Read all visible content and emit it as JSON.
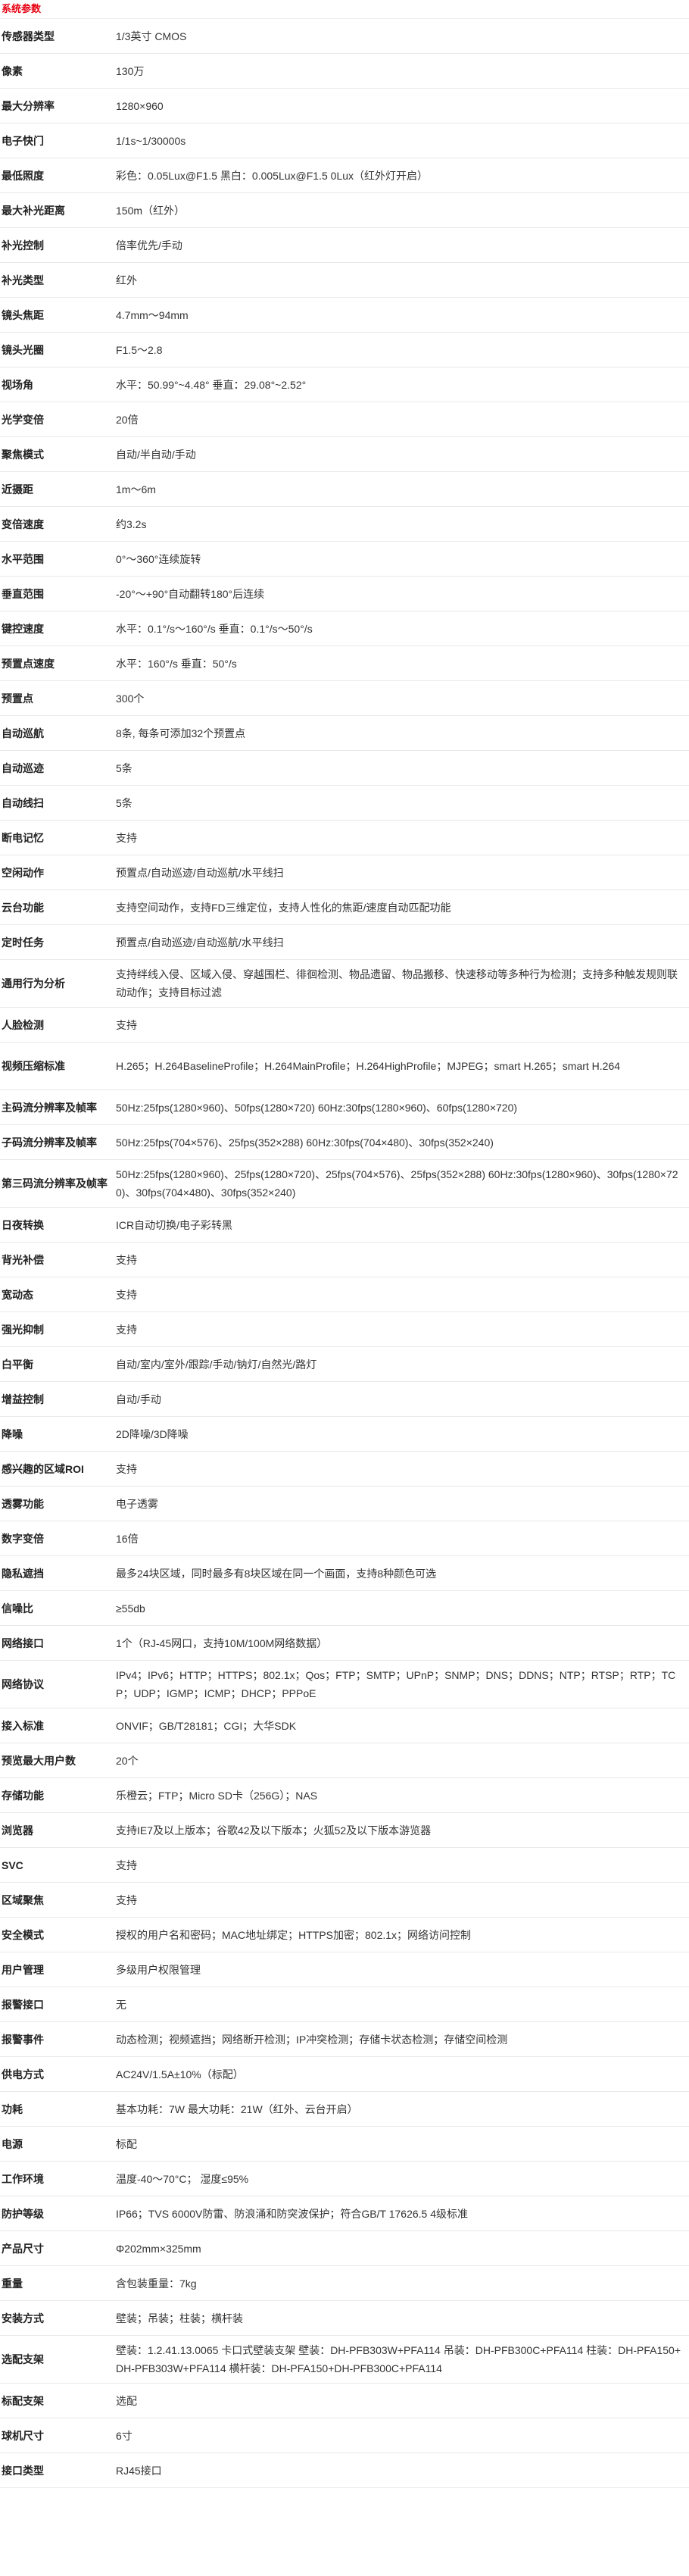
{
  "section_title": "系统参数",
  "rows": [
    {
      "label": "传感器类型",
      "value": "1/3英寸 CMOS"
    },
    {
      "label": "像素",
      "value": "130万"
    },
    {
      "label": "最大分辨率",
      "value": "1280×960"
    },
    {
      "label": "电子快门",
      "value": "1/1s~1/30000s"
    },
    {
      "label": "最低照度",
      "value": "彩色：0.05Lux@F1.5 黑白：0.005Lux@F1.5 0Lux（红外灯开启）"
    },
    {
      "label": "最大补光距离",
      "value": "150m（红外）"
    },
    {
      "label": "补光控制",
      "value": "倍率优先/手动"
    },
    {
      "label": "补光类型",
      "value": "红外"
    },
    {
      "label": "镜头焦距",
      "value": "4.7mm～94mm"
    },
    {
      "label": "镜头光圈",
      "value": "F1.5～2.8"
    },
    {
      "label": "视场角",
      "value": "水平：50.99°~4.48° 垂直：29.08°~2.52°"
    },
    {
      "label": "光学变倍",
      "value": "20倍"
    },
    {
      "label": "聚焦模式",
      "value": "自动/半自动/手动"
    },
    {
      "label": "近摄距",
      "value": "1m～6m"
    },
    {
      "label": "变倍速度",
      "value": "约3.2s"
    },
    {
      "label": "水平范围",
      "value": "0°～360°连续旋转"
    },
    {
      "label": "垂直范围",
      "value": " -20°～+90°自动翻转180°后连续"
    },
    {
      "label": "键控速度",
      "value": "水平：0.1°/s～160°/s 垂直：0.1°/s～50°/s"
    },
    {
      "label": "预置点速度",
      "value": "水平：160°/s 垂直：50°/s"
    },
    {
      "label": "预置点",
      "value": "300个"
    },
    {
      "label": "自动巡航",
      "value": "8条, 每条可添加32个预置点"
    },
    {
      "label": "自动巡迹",
      "value": "5条"
    },
    {
      "label": "自动线扫",
      "value": "5条"
    },
    {
      "label": "断电记忆",
      "value": "支持"
    },
    {
      "label": "空闲动作",
      "value": "预置点/自动巡迹/自动巡航/水平线扫"
    },
    {
      "label": "云台功能",
      "value": "支持空间动作，支持FD三维定位，支持人性化的焦距/速度自动匹配功能"
    },
    {
      "label": "定时任务",
      "value": "预置点/自动巡迹/自动巡航/水平线扫"
    },
    {
      "label": "通用行为分析",
      "value": "支持绊线入侵、区域入侵、穿越围栏、徘徊检测、物品遗留、物品搬移、快速移动等多种行为检测；支持多种触发规则联动动作；支持目标过滤",
      "lines": 2
    },
    {
      "label": "人脸检测",
      "value": "支持"
    },
    {
      "label": "视频压缩标准",
      "value": "H.265；H.264BaselineProfile；H.264MainProfile；H.264HighProfile；MJPEG；smart H.265；smart H.264",
      "lines": 2
    },
    {
      "label": "主码流分辨率及帧率",
      "value": "50Hz:25fps(1280×960)、50fps(1280×720) 60Hz:30fps(1280×960)、60fps(1280×720)"
    },
    {
      "label": "子码流分辨率及帧率",
      "value": "50Hz:25fps(704×576)、25fps(352×288) 60Hz:30fps(704×480)、30fps(352×240)"
    },
    {
      "label": "第三码流分辨率及帧率",
      "value": "50Hz:25fps(1280×960)、25fps(1280×720)、25fps(704×576)、25fps(352×288) 60Hz:30fps(1280×960)、30fps(1280×720)、30fps(704×480)、30fps(352×240)",
      "lines": 2
    },
    {
      "label": "日夜转换",
      "value": "ICR自动切换/电子彩转黑"
    },
    {
      "label": "背光补偿",
      "value": "支持"
    },
    {
      "label": "宽动态",
      "value": "支持"
    },
    {
      "label": "强光抑制",
      "value": "支持"
    },
    {
      "label": "白平衡",
      "value": "自动/室内/室外/跟踪/手动/钠灯/自然光/路灯"
    },
    {
      "label": "增益控制",
      "value": "自动/手动"
    },
    {
      "label": "降噪",
      "value": "2D降噪/3D降噪"
    },
    {
      "label": "感兴趣的区域ROI",
      "value": "支持"
    },
    {
      "label": "透雾功能",
      "value": "电子透雾"
    },
    {
      "label": "数字变倍",
      "value": "16倍"
    },
    {
      "label": "隐私遮挡",
      "value": "最多24块区域，同时最多有8块区域在同一个画面，支持8种颜色可选"
    },
    {
      "label": "信噪比",
      "value": "≥55db"
    },
    {
      "label": "网络接口",
      "value": "1个（RJ-45网口，支持10M/100M网络数据）"
    },
    {
      "label": "网络协议",
      "value": "IPv4；IPv6；HTTP；HTTPS；802.1x；Qos；FTP；SMTP；UPnP；SNMP；DNS；DDNS；NTP；RTSP；RTP；TCP；UDP；IGMP；ICMP；DHCP；PPPoE",
      "lines": 2
    },
    {
      "label": "接入标准",
      "value": "ONVIF；GB/T28181；CGI；大华SDK"
    },
    {
      "label": "预览最大用户数",
      "value": "20个"
    },
    {
      "label": "存储功能",
      "value": "乐橙云；FTP；Micro SD卡（256G）；NAS"
    },
    {
      "label": "浏览器",
      "value": "支持IE7及以上版本；谷歌42及以下版本；火狐52及以下版本游览器"
    },
    {
      "label": "SVC",
      "value": "支持"
    },
    {
      "label": "区域聚焦",
      "value": "支持"
    },
    {
      "label": "安全模式",
      "value": "授权的用户名和密码；MAC地址绑定；HTTPS加密；802.1x；网络访问控制"
    },
    {
      "label": "用户管理",
      "value": "多级用户权限管理"
    },
    {
      "label": "报警接口",
      "value": "无"
    },
    {
      "label": "报警事件",
      "value": "动态检测；视频遮挡；网络断开检测；IP冲突检测；存储卡状态检测；存储空间检测"
    },
    {
      "label": "供电方式",
      "value": "AC24V/1.5A±10%（标配）"
    },
    {
      "label": "功耗",
      "value": "基本功耗：7W 最大功耗：21W（红外、云台开启）"
    },
    {
      "label": "电源",
      "value": "标配"
    },
    {
      "label": "工作环境",
      "value": "温度-40～70°C； 湿度≤95%"
    },
    {
      "label": "防护等级",
      "value": "IP66；TVS 6000V防雷、防浪涌和防突波保护；符合GB/T 17626.5 4级标准"
    },
    {
      "label": "产品尺寸",
      "value": "Φ202mm×325mm"
    },
    {
      "label": "重量",
      "value": "含包装重量：7kg"
    },
    {
      "label": "安装方式",
      "value": "壁装；吊装；柱装；横杆装"
    },
    {
      "label": "选配支架",
      "value": "壁装：1.2.41.13.0065 卡口式壁装支架 壁装：DH-PFB303W+PFA114 吊装：DH-PFB300C+PFA114 柱装：DH-PFA150+DH-PFB303W+PFA114 横杆装：DH-PFA150+DH-PFB300C+PFA114",
      "lines": 2
    },
    {
      "label": "标配支架",
      "value": "选配"
    },
    {
      "label": "球机尺寸",
      "value": "6寸"
    },
    {
      "label": "接口类型",
      "value": "RJ45接口"
    }
  ]
}
